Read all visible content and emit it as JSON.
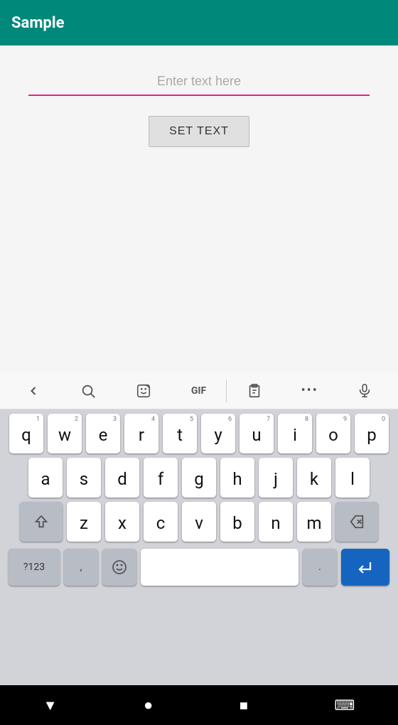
{
  "app_bar": {
    "title": "Sample"
  },
  "content": {
    "input_placeholder": "Enter text here",
    "set_text_button": "SET TEXT"
  },
  "keyboard": {
    "toolbar": {
      "back": "‹",
      "search": "🔍",
      "sticker": "🎭",
      "gif": "GIF",
      "clipboard": "📋",
      "more": "•••",
      "mic": "🎤"
    },
    "rows": [
      {
        "keys": [
          {
            "letter": "q",
            "number": "1"
          },
          {
            "letter": "w",
            "number": "2"
          },
          {
            "letter": "e",
            "number": "3"
          },
          {
            "letter": "r",
            "number": "4"
          },
          {
            "letter": "t",
            "number": "5"
          },
          {
            "letter": "y",
            "number": "6"
          },
          {
            "letter": "u",
            "number": "7"
          },
          {
            "letter": "i",
            "number": "8"
          },
          {
            "letter": "o",
            "number": "9"
          },
          {
            "letter": "p",
            "number": "0"
          }
        ]
      },
      {
        "keys": [
          {
            "letter": "a"
          },
          {
            "letter": "s"
          },
          {
            "letter": "d"
          },
          {
            "letter": "f"
          },
          {
            "letter": "g"
          },
          {
            "letter": "h"
          },
          {
            "letter": "j"
          },
          {
            "letter": "k"
          },
          {
            "letter": "l"
          }
        ]
      },
      {
        "keys": [
          {
            "letter": "z"
          },
          {
            "letter": "x"
          },
          {
            "letter": "c"
          },
          {
            "letter": "v"
          },
          {
            "letter": "b"
          },
          {
            "letter": "n"
          },
          {
            "letter": "m"
          }
        ]
      }
    ],
    "bottom_row": {
      "num_sym": "?123",
      "comma": ",",
      "space": "",
      "period": ".",
      "enter": "↵"
    }
  },
  "nav_bar": {
    "back": "▼",
    "home": "●",
    "recents": "■",
    "keyboard": "⌨"
  }
}
